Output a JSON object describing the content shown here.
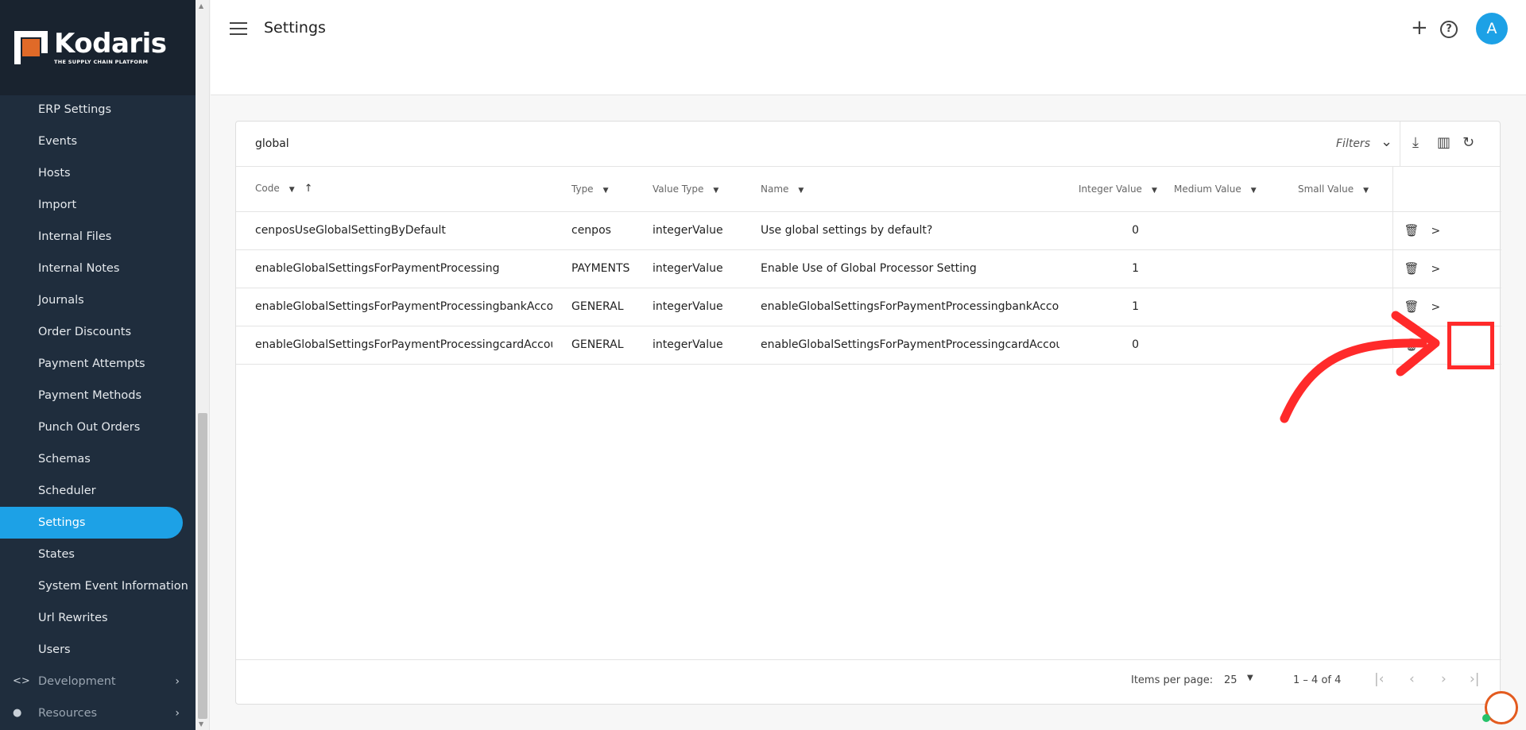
{
  "sidebar": {
    "brand": {
      "name": "Kodaris",
      "tagline": "THE SUPPLY CHAIN PLATFORM"
    },
    "items": [
      {
        "label": "ERP Settings"
      },
      {
        "label": "Events"
      },
      {
        "label": "Hosts"
      },
      {
        "label": "Import"
      },
      {
        "label": "Internal Files"
      },
      {
        "label": "Internal Notes"
      },
      {
        "label": "Journals"
      },
      {
        "label": "Order Discounts"
      },
      {
        "label": "Payment Attempts"
      },
      {
        "label": "Payment Methods"
      },
      {
        "label": "Punch Out Orders"
      },
      {
        "label": "Schemas"
      },
      {
        "label": "Scheduler"
      },
      {
        "label": "Settings",
        "active": true
      },
      {
        "label": "States"
      },
      {
        "label": "System Event Information"
      },
      {
        "label": "Url Rewrites"
      },
      {
        "label": "Users"
      }
    ],
    "groups": [
      {
        "label": "Development",
        "icon": "code-icon"
      },
      {
        "label": "Resources",
        "icon": "help-circle-icon"
      }
    ]
  },
  "header": {
    "title": "Settings",
    "avatar_initial": "A"
  },
  "toolbar": {
    "search_value": "global",
    "filters_label": "Filters"
  },
  "table": {
    "columns": [
      "Code",
      "Type",
      "Value Type",
      "Name",
      "Integer Value",
      "Medium Value",
      "Small Value"
    ],
    "rows": [
      {
        "code": "cenposUseGlobalSettingByDefault",
        "type": "cenpos",
        "value_type": "integerValue",
        "name": "Use global settings by default?",
        "integer_value": "0",
        "medium_value": "",
        "small_value": ""
      },
      {
        "code": "enableGlobalSettingsForPaymentProcessing",
        "type": "PAYMENTS",
        "value_type": "integerValue",
        "name": "Enable Use of Global Processor Setting",
        "integer_value": "1",
        "medium_value": "",
        "small_value": ""
      },
      {
        "code": "enableGlobalSettingsForPaymentProcessingbankAccount",
        "type": "GENERAL",
        "value_type": "integerValue",
        "name": "enableGlobalSettingsForPaymentProcessingbankAccount",
        "integer_value": "1",
        "medium_value": "",
        "small_value": ""
      },
      {
        "code": "enableGlobalSettingsForPaymentProcessingcardAccount",
        "type": "GENERAL",
        "value_type": "integerValue",
        "name": "enableGlobalSettingsForPaymentProcessingcardAccount",
        "integer_value": "0",
        "medium_value": "",
        "small_value": ""
      }
    ]
  },
  "paginator": {
    "items_per_page_label": "Items per page:",
    "items_per_page_value": "25",
    "range_label": "1 – 4 of 4"
  },
  "colors": {
    "sidebar_bg": "#1f2d3d",
    "accent": "#1da1e6",
    "annotation": "#ff2a2a"
  }
}
